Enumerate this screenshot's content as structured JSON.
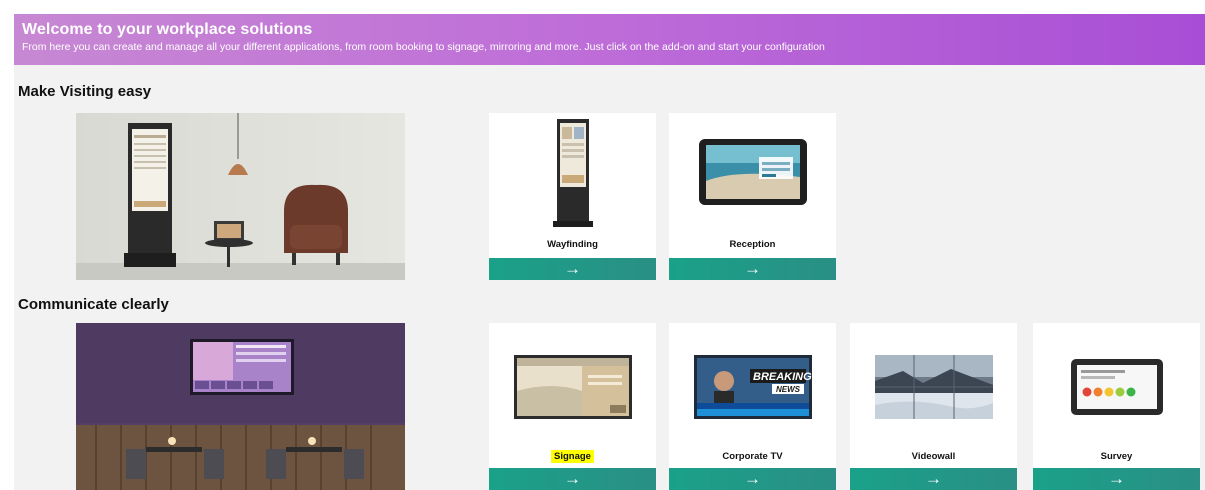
{
  "banner": {
    "title": "Welcome to your workplace solutions",
    "subtitle": "From here you can create and manage all your different applications, from room booking to signage, mirroring and more. Just click on the add-on and start your configuration"
  },
  "sections": [
    {
      "title": "Make Visiting easy",
      "cards": [
        {
          "label": "Wayfinding",
          "icon": "arrow-right-icon"
        },
        {
          "label": "Reception",
          "icon": "arrow-right-icon"
        }
      ]
    },
    {
      "title": "Communicate clearly",
      "cards": [
        {
          "label": "Signage",
          "icon": "arrow-right-icon"
        },
        {
          "label": "Corporate TV",
          "icon": "arrow-right-icon"
        },
        {
          "label": "Videowall",
          "icon": "arrow-right-icon"
        },
        {
          "label": "Survey",
          "icon": "arrow-right-icon"
        }
      ]
    }
  ],
  "arrow_glyph": "→",
  "thumbnail_text": {
    "breaking": "BREAKING",
    "news": "NEWS"
  },
  "colors": {
    "banner_start": "#c788d3",
    "banner_end": "#a84ed6",
    "button": "#1aa189",
    "highlight": "#ffff00",
    "background": "#f2f2f2"
  }
}
